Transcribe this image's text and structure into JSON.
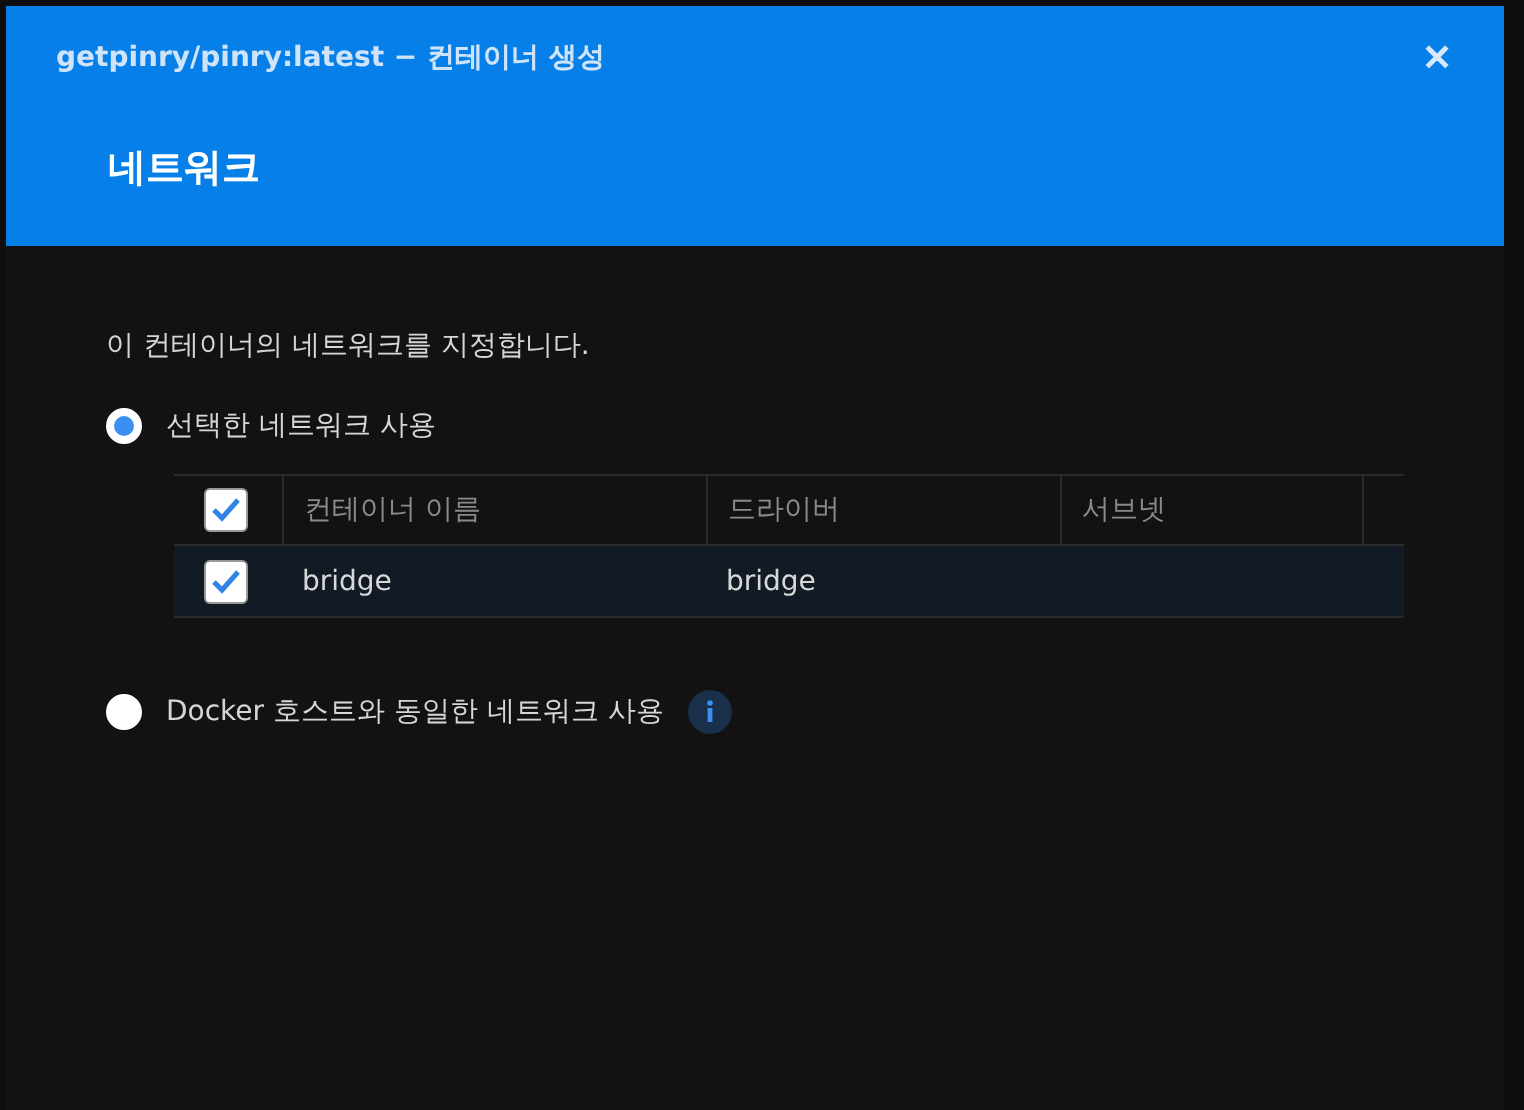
{
  "dialog": {
    "title": "getpinry/pinry:latest − 컨테이너 생성",
    "close": "✕",
    "heading": "네트워크"
  },
  "description": "이 컨테이너의 네트워크를 지정합니다.",
  "options": [
    {
      "label": "선택한 네트워크 사용",
      "selected": true
    },
    {
      "label": "Docker 호스트와 동일한 네트워크 사용",
      "selected": false,
      "info": true
    }
  ],
  "table": {
    "select_all": true,
    "columns": [
      "컨테이너 이름",
      "드라이버",
      "서브넷"
    ],
    "rows": [
      {
        "checked": true,
        "cells": [
          "bridge",
          "bridge",
          ""
        ]
      }
    ]
  }
}
